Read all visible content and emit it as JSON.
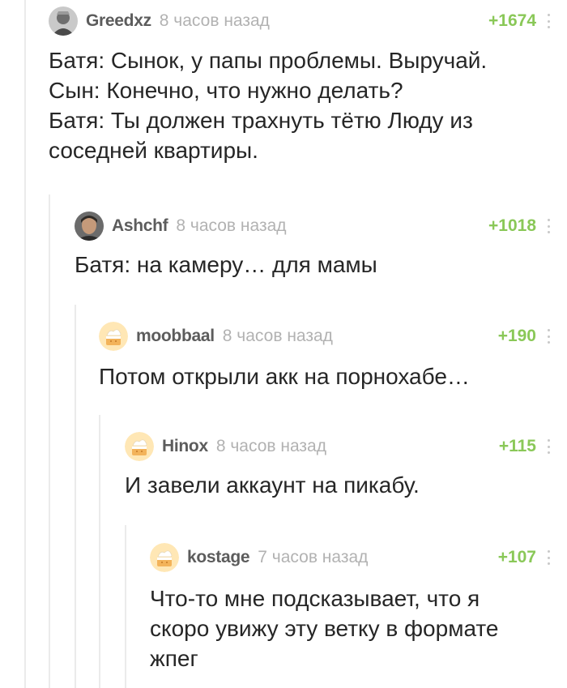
{
  "comments": [
    {
      "author": "Greedxz",
      "time": "8 часов назад",
      "rating": "+1674",
      "avatar": "avatar-photo-icon",
      "lines": [
        "Батя: Сынок, у папы проблемы. Выручай.",
        "Сын: Конечно, что нужно делать?",
        "Батя: Ты должен трахнуть тётю Люду из",
        "соседней квартиры."
      ]
    },
    {
      "author": "Ashchf",
      "time": "8 часов назад",
      "rating": "+1018",
      "avatar": "avatar-photo-icon",
      "lines": [
        "Батя: на камеру… для мамы"
      ]
    },
    {
      "author": "moobbaal",
      "time": "8 часов назад",
      "rating": "+190",
      "avatar": "default-cake-avatar-icon",
      "lines": [
        "Потом открыли акк на порнохабе…"
      ]
    },
    {
      "author": "Hinox",
      "time": "8 часов назад",
      "rating": "+115",
      "avatar": "default-cake-avatar-icon",
      "lines": [
        "И завели аккаунт на пикабу."
      ]
    },
    {
      "author": "kostage",
      "time": "7 часов назад",
      "rating": "+107",
      "avatar": "default-cake-avatar-icon",
      "lines": [
        "Что-то мне подсказывает, что я",
        "скоро увижу эту ветку в формате",
        "жпег"
      ]
    }
  ],
  "colors": {
    "rating": "#8ac858",
    "author": "#5c5c5c",
    "time": "#b2b2b2",
    "thread_line": "#ebebeb"
  }
}
